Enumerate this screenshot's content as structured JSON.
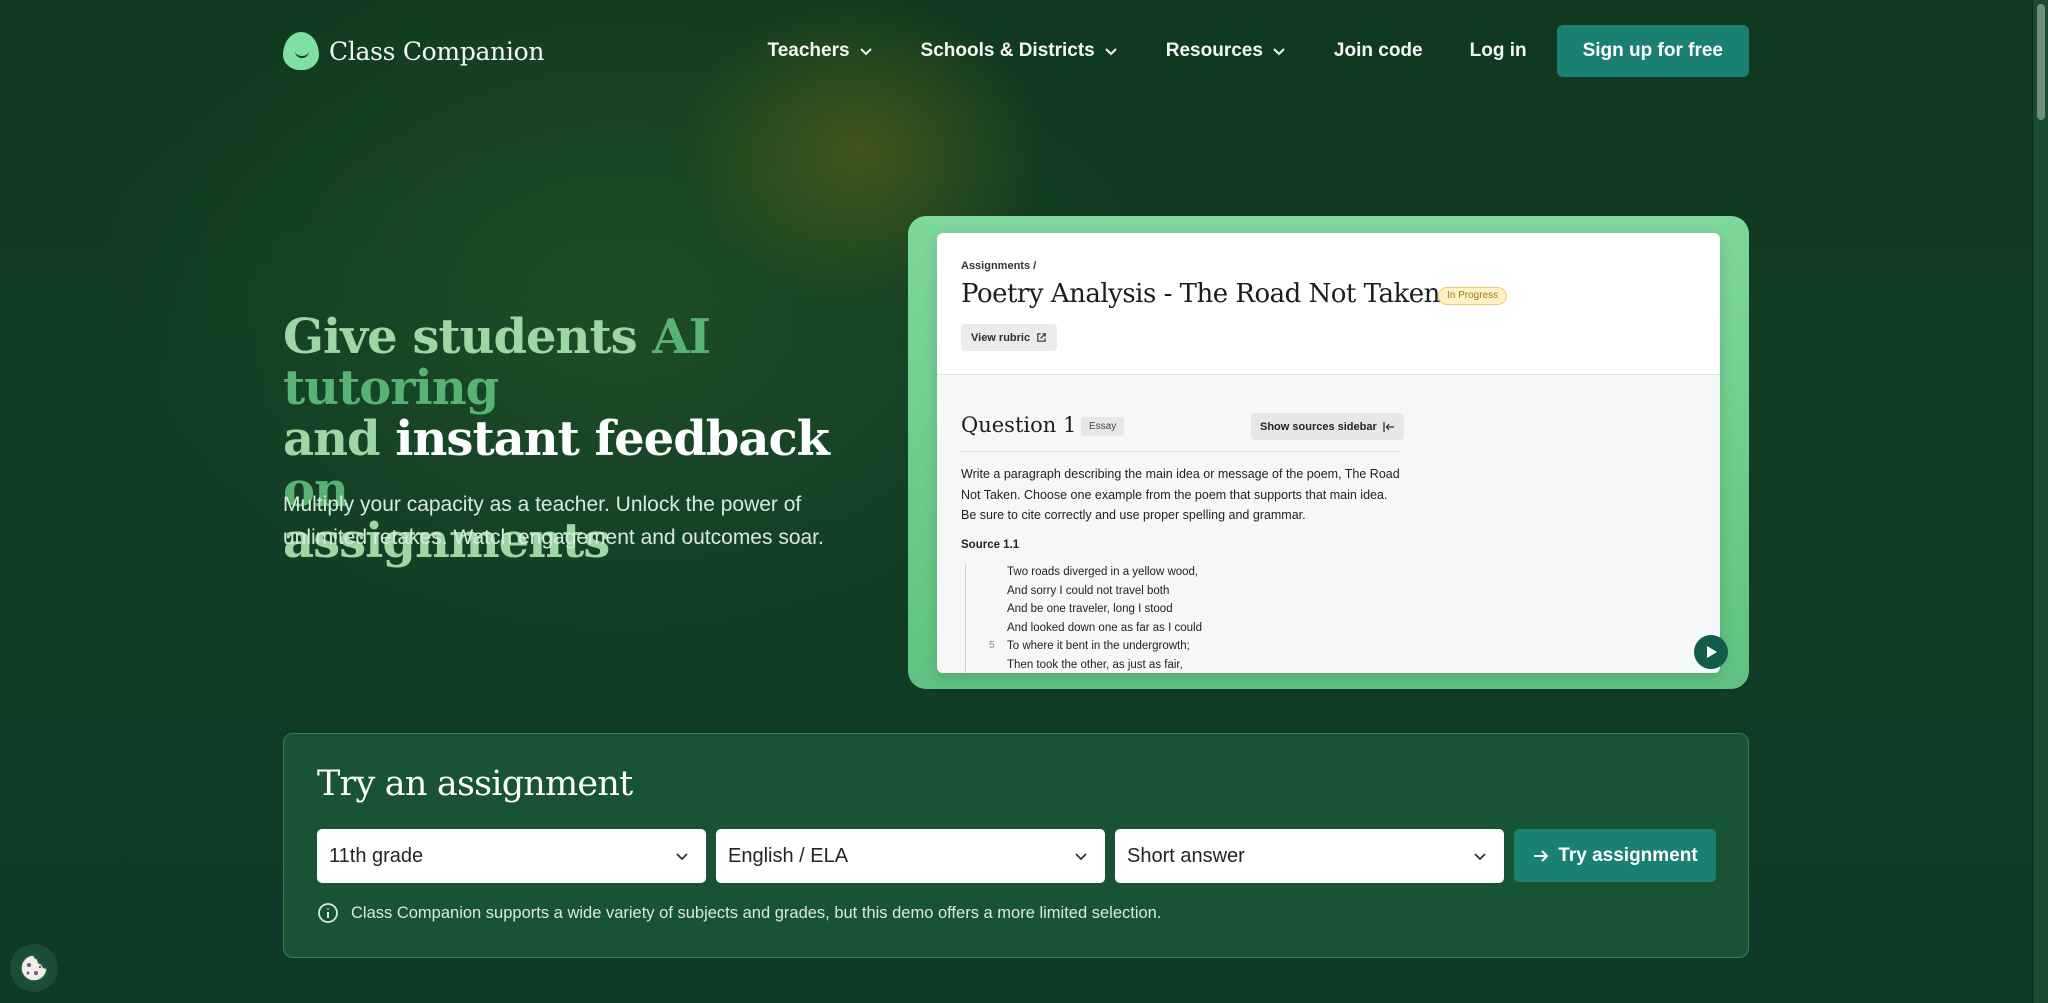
{
  "brand": {
    "name": "Class Companion"
  },
  "nav": {
    "items": [
      {
        "label": "Teachers",
        "has_dropdown": true
      },
      {
        "label": "Schools & Districts",
        "has_dropdown": true
      },
      {
        "label": "Resources",
        "has_dropdown": true
      },
      {
        "label": "Join code",
        "has_dropdown": false
      },
      {
        "label": "Log in",
        "has_dropdown": false
      }
    ],
    "cta": "Sign up for free"
  },
  "hero": {
    "title_parts": [
      "Give ",
      "students ",
      "AI tutoring",
      "and ",
      "instant feedback",
      " on",
      "assignments"
    ],
    "subtitle": "Multiply your capacity as a teacher. Unlock the power of unlimited retakes. Watch engagement and outcomes soar."
  },
  "preview": {
    "breadcrumb": "Assignments /",
    "title": "Poetry Analysis - The Road Not Taken",
    "status": "In Progress",
    "rubric_button": "View rubric",
    "question_title": "Question 1",
    "question_type": "Essay",
    "sources_button": "Show sources sidebar",
    "prompt": "Write a paragraph describing the main idea or message of the poem, The Road Not Taken. Choose one example from the poem that supports that main idea. Be sure to cite correctly and use proper spelling and grammar.",
    "source_label": "Source 1.1",
    "poem_lines": [
      "Two roads diverged in a yellow wood,",
      "And sorry I could not travel both",
      "And be one traveler, long I stood",
      "And looked down one as far as I could",
      "To where it bent in the undergrowth;",
      "Then took the other, as just as fair,"
    ],
    "line_number": "5"
  },
  "try": {
    "title": "Try an assignment",
    "grade": "11th grade",
    "subject": "English / ELA",
    "type": "Short answer",
    "button": "Try assignment",
    "note": "Class Companion supports a wide variety of subjects and grades, but this demo offers a more limited selection."
  },
  "colors": {
    "accent": "#1a8172",
    "background": "#0f3a24",
    "logo": "#7ee0a3"
  }
}
